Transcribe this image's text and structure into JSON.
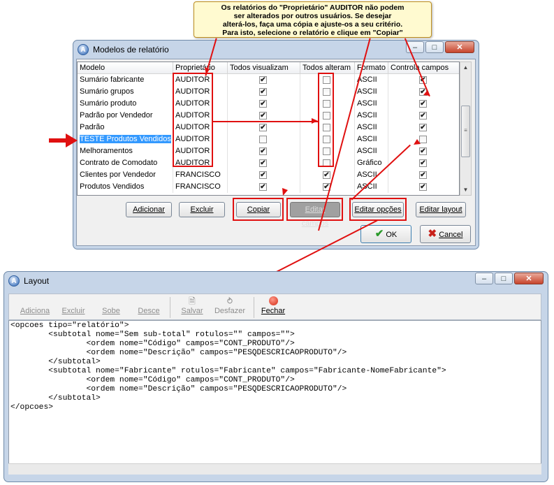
{
  "callout": {
    "line1": "Os relatórios do \"Proprietário\" AUDITOR não podem",
    "line2": "ser alterados por outros usuários. Se desejar",
    "line3": "alterá-los, faça uma cópia e ajuste-os a seu critério.",
    "line4": "Para isto, selecione o relatório e clique em \"Copiar\""
  },
  "dialog": {
    "title": "Modelos de relatório",
    "columns": [
      "Modelo",
      "Proprietário",
      "Todos visualizam",
      "Todos alteram",
      "Formato",
      "Controla campos"
    ],
    "rows": [
      {
        "modelo": "Sumário fabricante",
        "prop": "AUDITOR",
        "vis": true,
        "alt": false,
        "fmt": "ASCII",
        "ctrl": true
      },
      {
        "modelo": "Sumário grupos",
        "prop": "AUDITOR",
        "vis": true,
        "alt": false,
        "fmt": "ASCII",
        "ctrl": true
      },
      {
        "modelo": "Sumário produto",
        "prop": "AUDITOR",
        "vis": true,
        "alt": false,
        "fmt": "ASCII",
        "ctrl": true
      },
      {
        "modelo": "Padrão por Vendedor",
        "prop": "AUDITOR",
        "vis": true,
        "alt": false,
        "fmt": "ASCII",
        "ctrl": true
      },
      {
        "modelo": "Padrão",
        "prop": "AUDITOR",
        "vis": true,
        "alt": false,
        "fmt": "ASCII",
        "ctrl": true
      },
      {
        "modelo": "TESTE Produtos Vendidos",
        "prop": "AUDITOR",
        "vis": false,
        "alt": false,
        "fmt": "ASCII",
        "ctrl": false
      },
      {
        "modelo": "Melhoramentos",
        "prop": "AUDITOR",
        "vis": true,
        "alt": false,
        "fmt": "ASCII",
        "ctrl": true
      },
      {
        "modelo": "Contrato de Comodato",
        "prop": "AUDITOR",
        "vis": true,
        "alt": false,
        "fmt": "Gráfico",
        "ctrl": true
      },
      {
        "modelo": "Clientes por Vendedor",
        "prop": "FRANCISCO",
        "vis": true,
        "alt": true,
        "fmt": "ASCII",
        "ctrl": true
      },
      {
        "modelo": "Produtos Vendidos",
        "prop": "FRANCISCO",
        "vis": true,
        "alt": true,
        "fmt": "ASCII",
        "ctrl": true
      }
    ],
    "selected_row": 5,
    "buttons": {
      "adicionar": "Adicionar",
      "excluir": "Excluir",
      "copiar": "Copiar",
      "editar_campos": "Editar campos",
      "editar_opcoes": "Editar opções",
      "editar_layout": "Editar layout",
      "ok": "OK",
      "cancel": "Cancel"
    }
  },
  "layout": {
    "title": "Layout",
    "toolbar": [
      "Adiciona",
      "Excluir",
      "Sobe",
      "Desce",
      "Salvar",
      "Desfazer",
      "Fechar"
    ],
    "code": "<opcoes tipo=\"relatório\">\n        <subtotal nome=\"Sem sub-total\" rotulos=\"\" campos=\"\">\n                <ordem nome=\"Código\" campos=\"CONT_PRODUTO\"/>\n                <ordem nome=\"Descrição\" campos=\"PESQDESCRICAOPRODUTO\"/>\n        </subtotal>\n        <subtotal nome=\"Fabricante\" rotulos=\"Fabricante\" campos=\"Fabricante-NomeFabricante\">\n                <ordem nome=\"Código\" campos=\"CONT_PRODUTO\"/>\n                <ordem nome=\"Descrição\" campos=\"PESQDESCRICAOPRODUTO\"/>\n        </subtotal>\n</opcoes>"
  },
  "colors": {
    "annotation_red": "#e01010",
    "selection": "#3399ff",
    "window_frame": "#c6d5e8"
  }
}
